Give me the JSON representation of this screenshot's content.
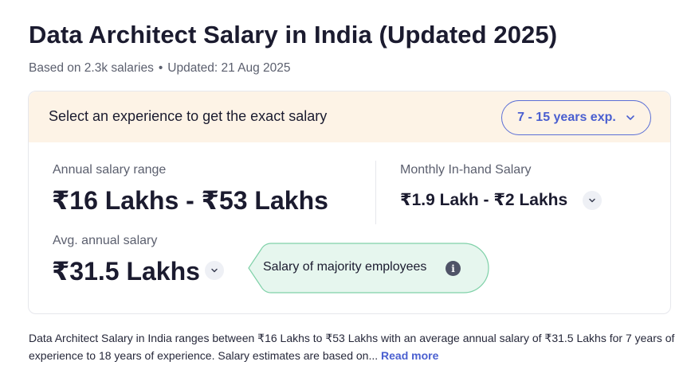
{
  "page": {
    "title": "Data Architect Salary in India (Updated 2025)",
    "based_on": "Based on 2.3k salaries",
    "separator": "•",
    "updated": "Updated: 21 Aug 2025"
  },
  "experience_selector": {
    "prompt": "Select an experience to get the exact salary",
    "selected": "7 - 15 years exp."
  },
  "salary": {
    "annual_range_label": "Annual salary range",
    "annual_range_value": "₹16 Lakhs - ₹53 Lakhs",
    "monthly_label": "Monthly In-hand Salary",
    "monthly_value": "₹1.9 Lakh - ₹2 Lakhs",
    "avg_label": "Avg. annual salary",
    "avg_value": "₹31.5 Lakhs",
    "majority_tooltip": "Salary of majority employees"
  },
  "description": {
    "text": "Data Architect Salary in India ranges between ₹16 Lakhs to ₹53 Lakhs with an average annual salary of ₹31.5 Lakhs for 7 years of experience to 18 years of experience. Salary estimates are based on...",
    "read_more": "Read more"
  },
  "icons": {
    "dropdown": "chevron-down-icon",
    "expand": "chevron-down-icon",
    "info": "info-icon"
  },
  "colors": {
    "accent": "#4a5fd0",
    "header_bg": "#fdf3e6",
    "bubble_bg": "#e6f6ee",
    "bubble_border": "#7fd1a8"
  }
}
